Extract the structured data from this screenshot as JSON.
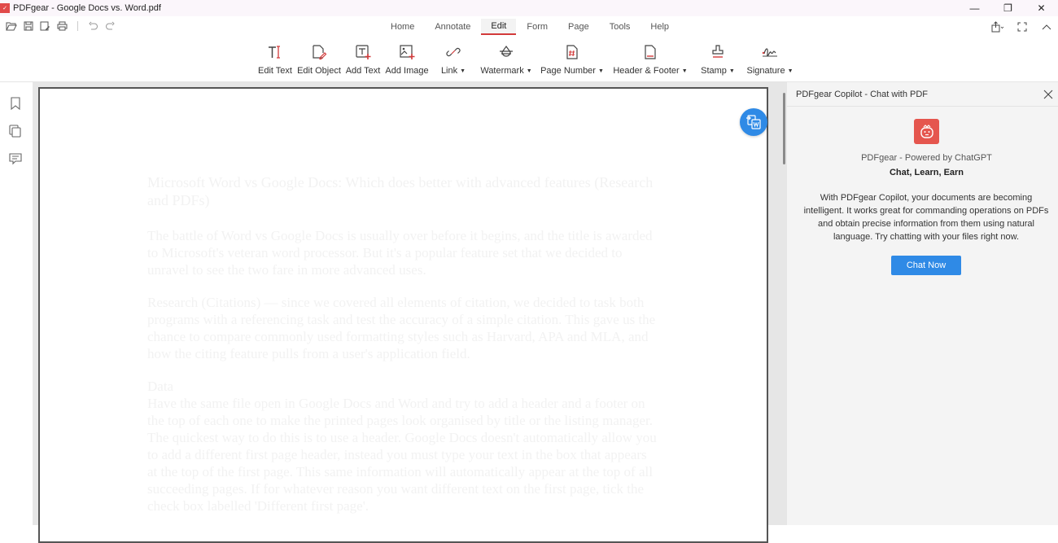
{
  "window": {
    "title": "PDFgear - Google Docs vs. Word.pdf",
    "controls": {
      "minimize": "—",
      "restore": "❐",
      "close": "✕"
    }
  },
  "quick_toolbar": {
    "icons": [
      "open-folder-icon",
      "save-icon",
      "save-as-icon",
      "print-icon",
      "undo-icon",
      "redo-icon"
    ]
  },
  "tabs": [
    {
      "label": "Home",
      "active": false
    },
    {
      "label": "Annotate",
      "active": false
    },
    {
      "label": "Edit",
      "active": true
    },
    {
      "label": "Form",
      "active": false
    },
    {
      "label": "Page",
      "active": false
    },
    {
      "label": "Tools",
      "active": false
    },
    {
      "label": "Help",
      "active": false
    }
  ],
  "right_tools": [
    "share-icon",
    "fullscreen-icon",
    "collapse-ribbon-icon"
  ],
  "ribbon": {
    "items": [
      {
        "label": "Edit Text",
        "icon": "edit-text-icon",
        "dropdown": false
      },
      {
        "label": "Edit Object",
        "icon": "edit-object-icon",
        "dropdown": false
      },
      {
        "label": "Add Text",
        "icon": "add-text-icon",
        "dropdown": false
      },
      {
        "label": "Add Image",
        "icon": "add-image-icon",
        "dropdown": false
      },
      {
        "label": "Link",
        "icon": "link-icon",
        "dropdown": true
      },
      {
        "label": "Watermark",
        "icon": "watermark-icon",
        "dropdown": true
      },
      {
        "label": "Page Number",
        "icon": "page-number-icon",
        "dropdown": true
      },
      {
        "label": "Header & Footer",
        "icon": "header-footer-icon",
        "dropdown": true
      },
      {
        "label": "Stamp",
        "icon": "stamp-icon",
        "dropdown": true
      },
      {
        "label": "Signature",
        "icon": "signature-icon",
        "dropdown": true
      }
    ]
  },
  "left_rail": [
    "bookmark-icon",
    "thumbnails-icon",
    "comments-icon"
  ],
  "document": {
    "heading": "Microsoft Word vs Google Docs: Which does better with advanced features (Research and PDFs)",
    "paragraphs": [
      "The battle of Word vs Google Docs is usually over before it begins, and the title is awarded to Microsoft's veteran word processor. But it's a popular feature set that we decided to unravel to see the two fare in more advanced uses.",
      "Research (Citations) — since we covered all elements of citation, we decided to task both programs with a referencing task and test the accuracy of a simple citation. This gave us the chance to compare commonly used formatting styles such as Harvard, APA and MLA, and how the citing feature pulls from a user's application field."
    ],
    "subheading": "Data",
    "last_paragraph": "Have the same file open in Google Docs and Word and try to add a header and a footer on the top of each one to make the printed pages look organised by title or the listing manager. The quickest way to do this is to use a header. Google Docs doesn't automatically allow you to add a different first page header, instead you must type your text in the box that appears at the top of the first page. This same information will automatically appear at the top of all succeeding pages. If for whatever reason you want different text on the first page, tick the check box labelled 'Different first page'."
  },
  "convert_button": {
    "icon": "convert-to-word-icon"
  },
  "copilot": {
    "header": "PDFgear Copilot - Chat with PDF",
    "powered_by": "PDFgear - Powered by ChatGPT",
    "tagline": "Chat, Learn, Earn",
    "description": "With PDFgear Copilot, your documents are becoming intelligent. It works great for commanding operations on PDFs and obtain precise information from them using natural language. Try chatting with your files right now.",
    "chat_button": "Chat Now",
    "accent_color": "#2f8ae6",
    "logo_color": "#e5564e"
  }
}
